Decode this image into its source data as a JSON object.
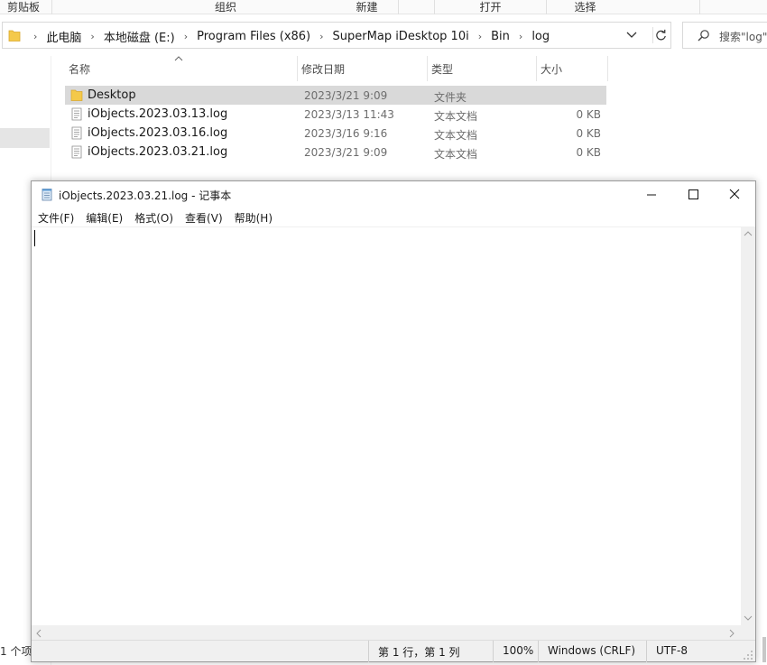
{
  "explorer": {
    "ribbon_groups": [
      "剪贴板",
      "组织",
      "新建",
      "打开",
      "选择"
    ],
    "breadcrumbs": [
      "此电脑",
      "本地磁盘 (E:)",
      "Program Files (x86)",
      "SuperMap iDesktop 10i",
      "Bin",
      "log"
    ],
    "search_placeholder": "搜索\"log\"",
    "columns": [
      "名称",
      "修改日期",
      "类型",
      "大小"
    ],
    "files": [
      {
        "name": "Desktop",
        "date": "2023/3/21 9:09",
        "type": "文件夹",
        "size": "",
        "icon": "folder-icon",
        "selected": true
      },
      {
        "name": "iObjects.2023.03.13.log",
        "date": "2023/3/13 11:43",
        "type": "文本文档",
        "size": "0 KB",
        "icon": "text-file-icon",
        "selected": false
      },
      {
        "name": "iObjects.2023.03.16.log",
        "date": "2023/3/16 9:16",
        "type": "文本文档",
        "size": "0 KB",
        "icon": "text-file-icon",
        "selected": false
      },
      {
        "name": "iObjects.2023.03.21.log",
        "date": "2023/3/21 9:09",
        "type": "文本文档",
        "size": "0 KB",
        "icon": "text-file-icon",
        "selected": false
      }
    ],
    "status_text": "1 个项"
  },
  "notepad": {
    "title": "iObjects.2023.03.21.log - 记事本",
    "menu": [
      "文件(F)",
      "编辑(E)",
      "格式(O)",
      "查看(V)",
      "帮助(H)"
    ],
    "content": "",
    "status": {
      "position": "第 1 行，第 1 列",
      "zoom": "100%",
      "line_ending": "Windows (CRLF)",
      "encoding": "UTF-8"
    }
  },
  "colors": {
    "folder": "#f4c94a",
    "selected_row": "#d9d9d9",
    "status_bar": "#f0f0f0"
  }
}
